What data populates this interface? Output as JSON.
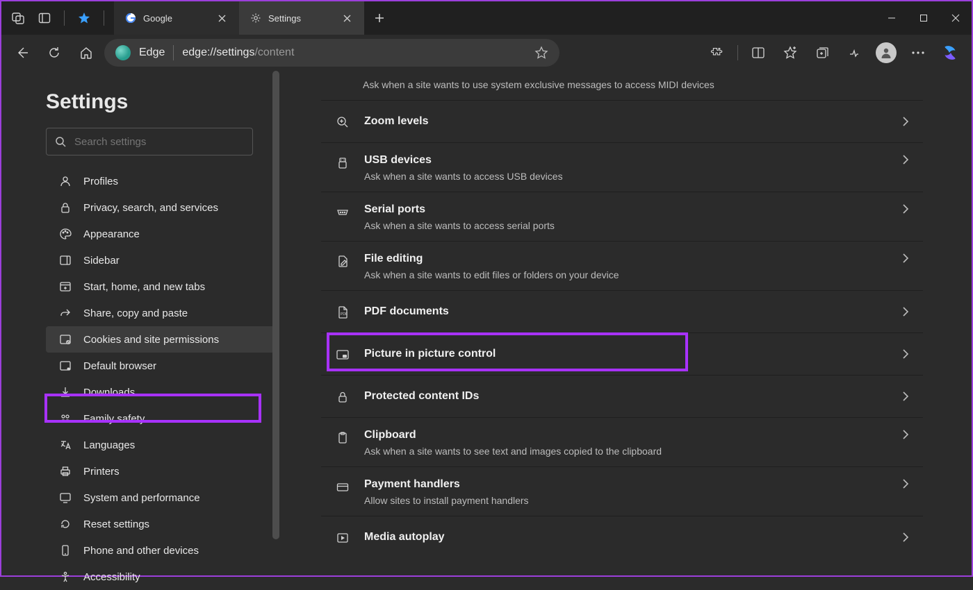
{
  "window": {
    "tabs": [
      {
        "label": "Google",
        "active": false
      },
      {
        "label": "Settings",
        "active": true
      }
    ]
  },
  "address": {
    "brand": "Edge",
    "url_host": "edge://settings",
    "url_path": "/content"
  },
  "sidebar": {
    "title": "Settings",
    "search_placeholder": "Search settings",
    "items": [
      {
        "label": "Profiles"
      },
      {
        "label": "Privacy, search, and services"
      },
      {
        "label": "Appearance"
      },
      {
        "label": "Sidebar"
      },
      {
        "label": "Start, home, and new tabs"
      },
      {
        "label": "Share, copy and paste"
      },
      {
        "label": "Cookies and site permissions",
        "selected": true,
        "highlight": true
      },
      {
        "label": "Default browser"
      },
      {
        "label": "Downloads"
      },
      {
        "label": "Family safety"
      },
      {
        "label": "Languages"
      },
      {
        "label": "Printers"
      },
      {
        "label": "System and performance"
      },
      {
        "label": "Reset settings"
      },
      {
        "label": "Phone and other devices"
      },
      {
        "label": "Accessibility"
      }
    ]
  },
  "main": {
    "top_sub": "Ask when a site wants to use system exclusive messages to access MIDI devices",
    "rows": [
      {
        "title": "Zoom levels"
      },
      {
        "title": "USB devices",
        "sub": "Ask when a site wants to access USB devices"
      },
      {
        "title": "Serial ports",
        "sub": "Ask when a site wants to access serial ports"
      },
      {
        "title": "File editing",
        "sub": "Ask when a site wants to edit files or folders on your device"
      },
      {
        "title": "PDF documents"
      },
      {
        "title": "Picture in picture control",
        "highlight": true
      },
      {
        "title": "Protected content IDs"
      },
      {
        "title": "Clipboard",
        "sub": "Ask when a site wants to see text and images copied to the clipboard"
      },
      {
        "title": "Payment handlers",
        "sub": "Allow sites to install payment handlers"
      },
      {
        "title": "Media autoplay"
      }
    ]
  }
}
